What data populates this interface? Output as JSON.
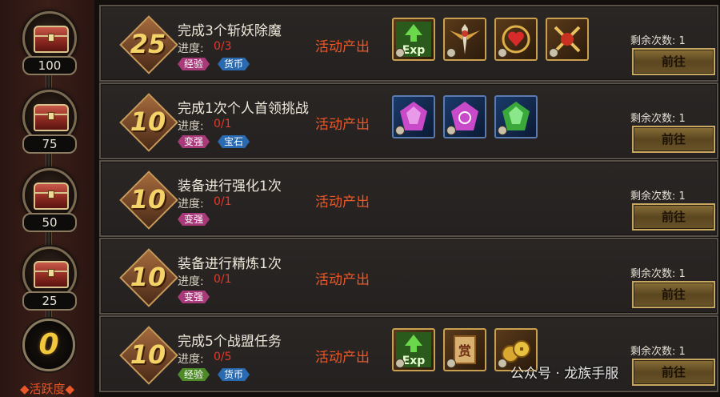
{
  "track": {
    "chests": [
      {
        "label": "100"
      },
      {
        "label": "75"
      },
      {
        "label": "50"
      },
      {
        "label": "25"
      }
    ],
    "score": "0",
    "caption": "◆活跃度◆"
  },
  "tasks": [
    {
      "points": "25",
      "title": "完成3个斩妖除魔",
      "progress_label": "进度:",
      "progress": "0/3",
      "tags": [
        "经验",
        "货币"
      ],
      "source": "活动产出",
      "remain": "剩余次数: 1",
      "button": "前往",
      "rewards": [
        "exp-icon",
        "sword-medal-icon",
        "heart-emblem-icon",
        "crossed-swords-icon"
      ]
    },
    {
      "points": "10",
      "title": "完成1次个人首领挑战",
      "progress_label": "进度:",
      "progress": "0/1",
      "tags": [
        "变强",
        "宝石"
      ],
      "source": "活动产出",
      "remain": "剩余次数: 1",
      "button": "前往",
      "rewards": [
        "pink-gem-icon",
        "pink-gem-icon",
        "green-gem-icon"
      ]
    },
    {
      "points": "10",
      "title": "装备进行强化1次",
      "progress_label": "进度:",
      "progress": "0/1",
      "tags": [
        "变强"
      ],
      "source": "活动产出",
      "remain": "剩余次数: 1",
      "button": "前往",
      "rewards": []
    },
    {
      "points": "10",
      "title": "装备进行精炼1次",
      "progress_label": "进度:",
      "progress": "0/1",
      "tags": [
        "变强"
      ],
      "source": "活动产出",
      "remain": "剩余次数: 1",
      "button": "前往",
      "rewards": []
    },
    {
      "points": "10",
      "title": "完成5个战盟任务",
      "progress_label": "进度:",
      "progress": "0/5",
      "tags": [
        "经验",
        "货币"
      ],
      "source": "活动产出",
      "remain": "剩余次数: 1",
      "button": "前往",
      "rewards": [
        "exp-icon",
        "reward-token-icon",
        "coin-stack-icon"
      ]
    }
  ],
  "reward_text": {
    "exp": "Exp",
    "token": "赏"
  },
  "watermark": "公众号 · 龙族手服",
  "colors": {
    "accent": "#e8582a",
    "progress": "#e43a2a",
    "points": "#f4d468"
  }
}
